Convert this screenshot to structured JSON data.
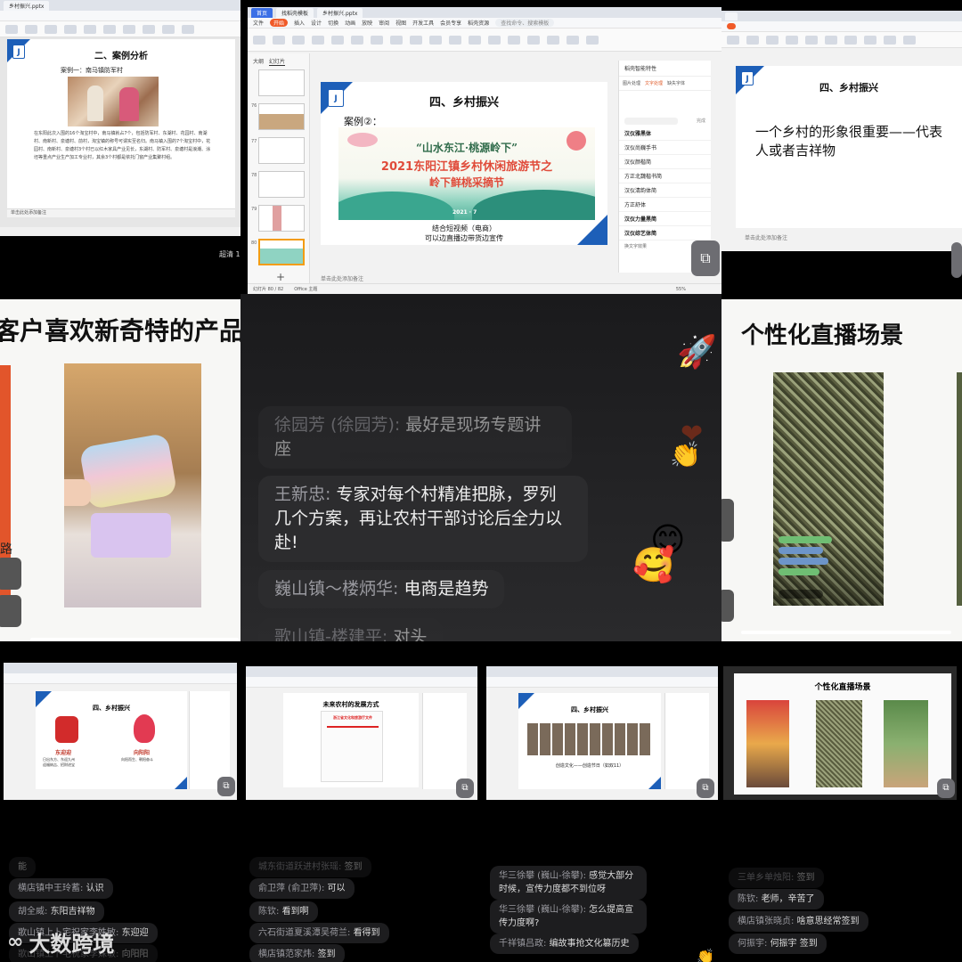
{
  "tile1": {
    "file_tab": "乡村振兴.pptx",
    "slide_title": "二、案例分析",
    "case_label": "案例一：南马镇防军村",
    "paragraph": "在东阳此次入围的16个淘宝村中，南马镇就占7个，包括防军村、东湖村、花园村、南湖村、南新村、泉塘村、前村，淘宝镇的称号可谓实至名归。南马镇入围的7个淘宝村中，花园村、南新村、泉塘村3个村已以红木家具产业见长，东湖村、防军村、泉塘村是浪潮、涂坯等重点产业生产加工专业村，其余3个村都是依托门窗产业集聚村组。",
    "status": "单击此处添加备注",
    "cancel": "超清 1"
  },
  "tile2": {
    "tabs": [
      "首页",
      "找稻壳模板",
      "乡村振兴.pptx"
    ],
    "menu": [
      "文件",
      "开始",
      "插入",
      "设计",
      "切换",
      "动画",
      "放映",
      "审阅",
      "视图",
      "开发工具",
      "会员专享",
      "稻壳资源"
    ],
    "active_menu": "开始",
    "search": "查找命令、搜索模板",
    "sidebar_tabs": [
      "大纲",
      "幻灯片"
    ],
    "slide_numbers": [
      "76",
      "77",
      "78",
      "79",
      "80"
    ],
    "slide_title": "四、乡村振兴",
    "case": "案例②：",
    "poster_script": "“山水东江·桃源岭下”",
    "poster_line1": "2021东阳江镇乡村休闲旅游节之",
    "poster_line2": "岭下鲜桃采摘节",
    "poster_date": "2021 · 7",
    "caption1": "结合短视频（电商）",
    "caption2": "可以边直播边带货边宣传",
    "panel_title": "稻壳智能特性",
    "panel_tabs": [
      "图片处理",
      "文字处理",
      "缺失字体"
    ],
    "fonts": [
      "汉仪雅黑体",
      "汉仪尚巍手书",
      "汉仪颜楷简",
      "方正北魏楷书简",
      "汉仪清韵体简",
      "方正舒体",
      "汉仪力量黑简",
      "汉仪综艺体简"
    ],
    "font_btn": "完成",
    "panel_footer": "换文字效果",
    "notes": "单击此处添加备注",
    "status_left": "幻灯片 80 / 82",
    "status_theme": "Office 主题",
    "zoom": "55%"
  },
  "tile3": {
    "slide_title": "四、乡村振兴",
    "text": "一个乡村的形象很重要——代表人或者吉祥物",
    "notes": "单击此处添加备注"
  },
  "tile4": {
    "heading": "客户喜欢新奇特的产品",
    "side_char": "路"
  },
  "chat_big": [
    {
      "name": "徐园芳 (徐园芳): ",
      "text": "最好是现场专题讲座",
      "dim": true
    },
    {
      "name": "王新忠: ",
      "text": "专家对每个村精准把脉，罗列几个方案，再让农村干部讨论后全力以赴!",
      "dim": false
    },
    {
      "name": "巍山镇～楼炳华: ",
      "text": "电商是趋势",
      "dim": false
    },
    {
      "name": "歌山镇-楼建平: ",
      "text": "对头",
      "dim": true
    }
  ],
  "tile6": {
    "heading": "个性化直播场景"
  },
  "mini1": {
    "title": "四、乡村振兴",
    "left_caption": "东迎迎",
    "left_sub": "日出东方、东迎九州\n迎福纳吉、招财进宝",
    "right_caption": "向阳阳",
    "right_sub": "向阳而生、朝阳奋斗"
  },
  "mini2": {
    "title": "未来农村的发展方式",
    "doc_title": "浙江省文化和旅游厅文件"
  },
  "mini3": {
    "title": "四、乡村振兴",
    "caption": "创造文化——创造节日（如双11）"
  },
  "mini4": {
    "title": "个性化直播场景"
  },
  "chat_col1": [
    {
      "name": "",
      "text": "能",
      "dim": true
    },
    {
      "name": "横店镇中王玲蓄: ",
      "text": "认识",
      "dim": false
    },
    {
      "name": "胡全威: ",
      "text": "东阳吉祥物",
      "dim": false
    },
    {
      "name": "歌山镇上卜宅祝家李姝敏: ",
      "text": "东迎迎",
      "dim": false
    },
    {
      "name": "歌山镇上卜宅祝家李姝敏: ",
      "text": "向阳阳",
      "dim": true
    }
  ],
  "chat_col2": [
    {
      "name": "城东街道跃进村张瑶: ",
      "text": "签到",
      "dim": true
    },
    {
      "name": "俞卫萍 (俞卫萍): ",
      "text": "可以",
      "dim": false
    },
    {
      "name": "陈钦: ",
      "text": "看到啊",
      "dim": false
    },
    {
      "name": "六石街道夏溪潭吴荷兰: ",
      "text": "看得到",
      "dim": false
    },
    {
      "name": "横店镇范家炜: ",
      "text": "签到",
      "dim": false
    }
  ],
  "chat_col3": [
    {
      "name": "华三徐攀 (巍山-徐攀): ",
      "text": "感觉大部分时候，宣传力度都不到位呀",
      "dim": false
    },
    {
      "name": "华三徐攀 (巍山-徐攀): ",
      "text": "怎么提高宣传力度啊?",
      "dim": false
    },
    {
      "name": "千祥镇吕政: ",
      "text": "编故事抢文化篡历史",
      "dim": false
    }
  ],
  "chat_col4": [
    {
      "name": "三单乡单烛阳: ",
      "text": "签到",
      "dim": true
    },
    {
      "name": "陈钦: ",
      "text": "老师，辛苦了",
      "dim": false
    },
    {
      "name": "横店镇张晓贞: ",
      "text": "啥意思经常签到",
      "dim": false
    },
    {
      "name": "何振宇: ",
      "text": "何振宇 签到",
      "dim": false
    }
  ],
  "watermark": "大数跨境",
  "colors": {
    "accent_blue": "#1d5fb8",
    "wps_orange": "#f05a28",
    "chat_bubble": "#2c2c2e"
  }
}
